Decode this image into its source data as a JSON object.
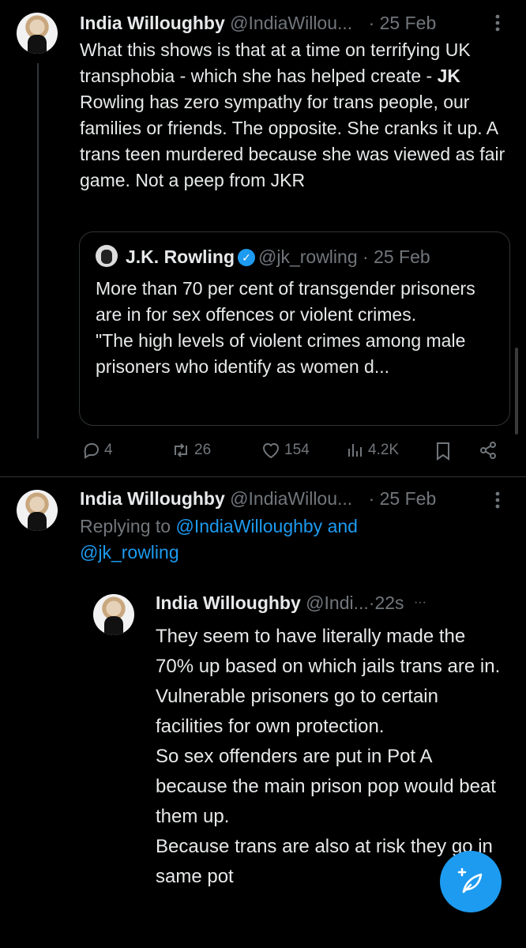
{
  "tweet1": {
    "name": "India Willoughby",
    "handle": "@IndiaWillou...",
    "dot": "·",
    "date": "25 Feb",
    "text_html_parts": [
      "What this shows is that at a time on terrifying UK transphobia - which she has helped create - ",
      "JK",
      " Rowling has zero sympathy for trans people, our families or friends.  The opposite.  She cranks it up.  A trans teen murdered because she was viewed as fair game. Not a peep from JKR"
    ],
    "quote": {
      "name": "J.K. Rowling",
      "handle": "@jk_rowling",
      "dot": "·",
      "date": "25 Feb",
      "line1": "More than 70 per cent of transgender prisoners are in for sex offences or violent crimes.",
      "line2": "\"The high levels of violent crimes among male prisoners who identify as women d..."
    },
    "actions": {
      "replies": "4",
      "reposts": "26",
      "likes": "154",
      "views": "4.2K"
    }
  },
  "tweet2": {
    "name": "India Willoughby",
    "handle": "@IndiaWillou...",
    "dot": "·",
    "date": "25 Feb",
    "replying_prefix": "Replying to",
    "replying_to": "@IndiaWilloughby and @jk_rowling"
  },
  "tweet3": {
    "name": "India Willoughby",
    "handle": "@Indi...",
    "dot": "·",
    "time": "22s",
    "more": "···",
    "text_lines": [
      "They seem to have literally made the 70% up based on which jails trans are in. Vulnerable prisoners go to certain facilities for own protection.",
      "So sex offenders are put in Pot A because the main prison pop would beat them up.",
      "Because trans are also at risk they go in same pot"
    ]
  },
  "icons": [
    "more-vertical-icon",
    "verified-badge-icon",
    "reply-icon",
    "repost-icon",
    "like-icon",
    "views-icon",
    "bookmark-icon",
    "share-icon",
    "compose-icon"
  ],
  "colors": {
    "accent": "#1d9bf0",
    "muted": "#71767b",
    "background": "#000000"
  }
}
